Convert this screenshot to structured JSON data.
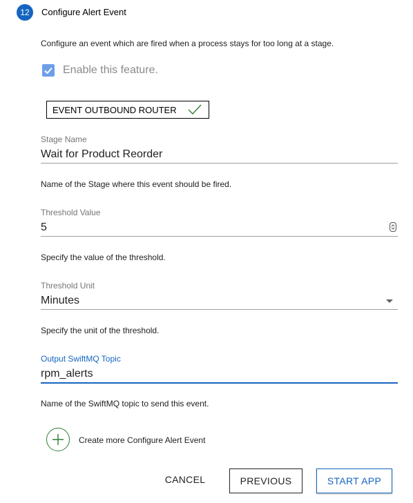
{
  "step": {
    "number": "12",
    "title": "Configure Alert Event"
  },
  "description": "Configure an event which are fired when a process stays for too long at a stage.",
  "enable_checkbox": {
    "label": "Enable this feature.",
    "checked": true
  },
  "chip": {
    "label": "EVENT OUTBOUND ROUTER"
  },
  "fields": {
    "stage_name": {
      "label": "Stage Name",
      "value": "Wait for Product Reorder",
      "helper": "Name of the Stage where this event should be fired."
    },
    "threshold_value": {
      "label": "Threshold Value",
      "value": "5",
      "helper": "Specify the value of the threshold."
    },
    "threshold_unit": {
      "label": "Threshold Unit",
      "value": "Minutes",
      "helper": "Specify the unit of the threshold."
    },
    "output_topic": {
      "label": "Output SwiftMQ Topic",
      "value": "rpm_alerts",
      "helper": "Name of the SwiftMQ topic to send this event."
    }
  },
  "add_more": {
    "label": "Create more Configure Alert Event"
  },
  "buttons": {
    "cancel": "CANCEL",
    "previous": "PREVIOUS",
    "start": "START APP"
  },
  "colors": {
    "primary": "#1565c0",
    "success": "#2e7d32",
    "checkbox": "#6d9ee8"
  }
}
